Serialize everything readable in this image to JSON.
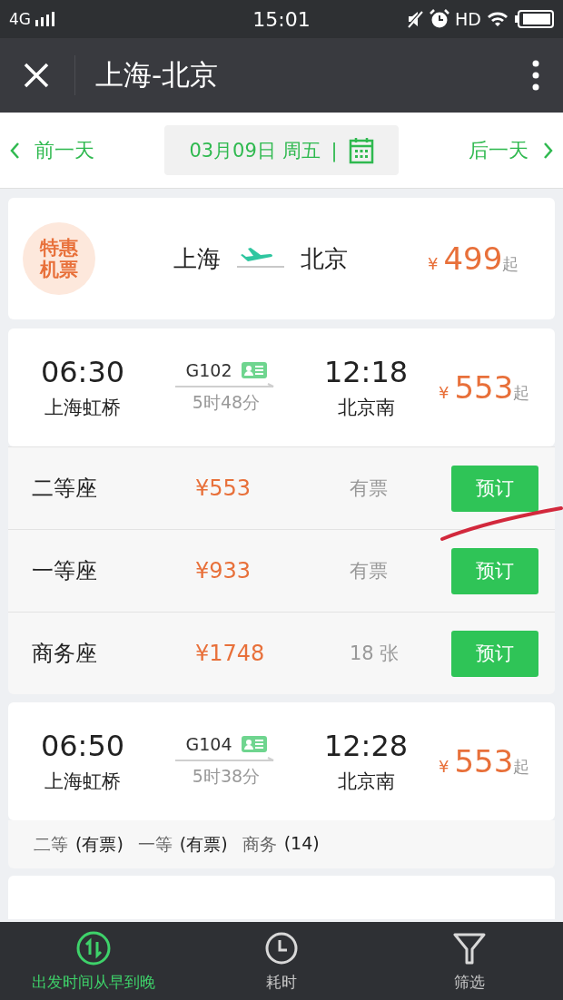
{
  "status_bar": {
    "network": "4G",
    "time": "15:01",
    "hd": "HD"
  },
  "header": {
    "title": "上海-北京"
  },
  "date_bar": {
    "prev": "前一天",
    "date": "03月09日 周五",
    "separator": "|",
    "next": "后一天"
  },
  "promo": {
    "badge": "特惠机票",
    "from": "上海",
    "to": "北京",
    "currency": "¥",
    "price": "499",
    "suffix": "起"
  },
  "trains": [
    {
      "depart_time": "06:30",
      "train_no": "G102",
      "arrive_time": "12:18",
      "depart_station": "上海虹桥",
      "duration": "5时48分",
      "arrive_station": "北京南",
      "currency": "¥",
      "price": "553",
      "suffix": "起",
      "seats": [
        {
          "name": "二等座",
          "price": "¥553",
          "availability": "有票",
          "button": "预订"
        },
        {
          "name": "一等座",
          "price": "¥933",
          "availability": "有票",
          "button": "预订"
        },
        {
          "name": "商务座",
          "price": "¥1748",
          "availability": "18 张",
          "button": "预订"
        }
      ]
    },
    {
      "depart_time": "06:50",
      "train_no": "G104",
      "arrive_time": "12:28",
      "depart_station": "上海虹桥",
      "duration": "5时38分",
      "arrive_station": "北京南",
      "currency": "¥",
      "price": "553",
      "suffix": "起",
      "summary": [
        {
          "class": "二等",
          "count": "(有票)"
        },
        {
          "class": "一等",
          "count": "(有票)"
        },
        {
          "class": "商务",
          "count": "(14)"
        }
      ]
    }
  ],
  "bottom_tabs": [
    {
      "kind": "sort",
      "label": "出发时间从早到晚",
      "selected": true
    },
    {
      "kind": "clock",
      "label": "耗时",
      "selected": false
    },
    {
      "kind": "filter",
      "label": "筛选",
      "selected": false
    }
  ]
}
